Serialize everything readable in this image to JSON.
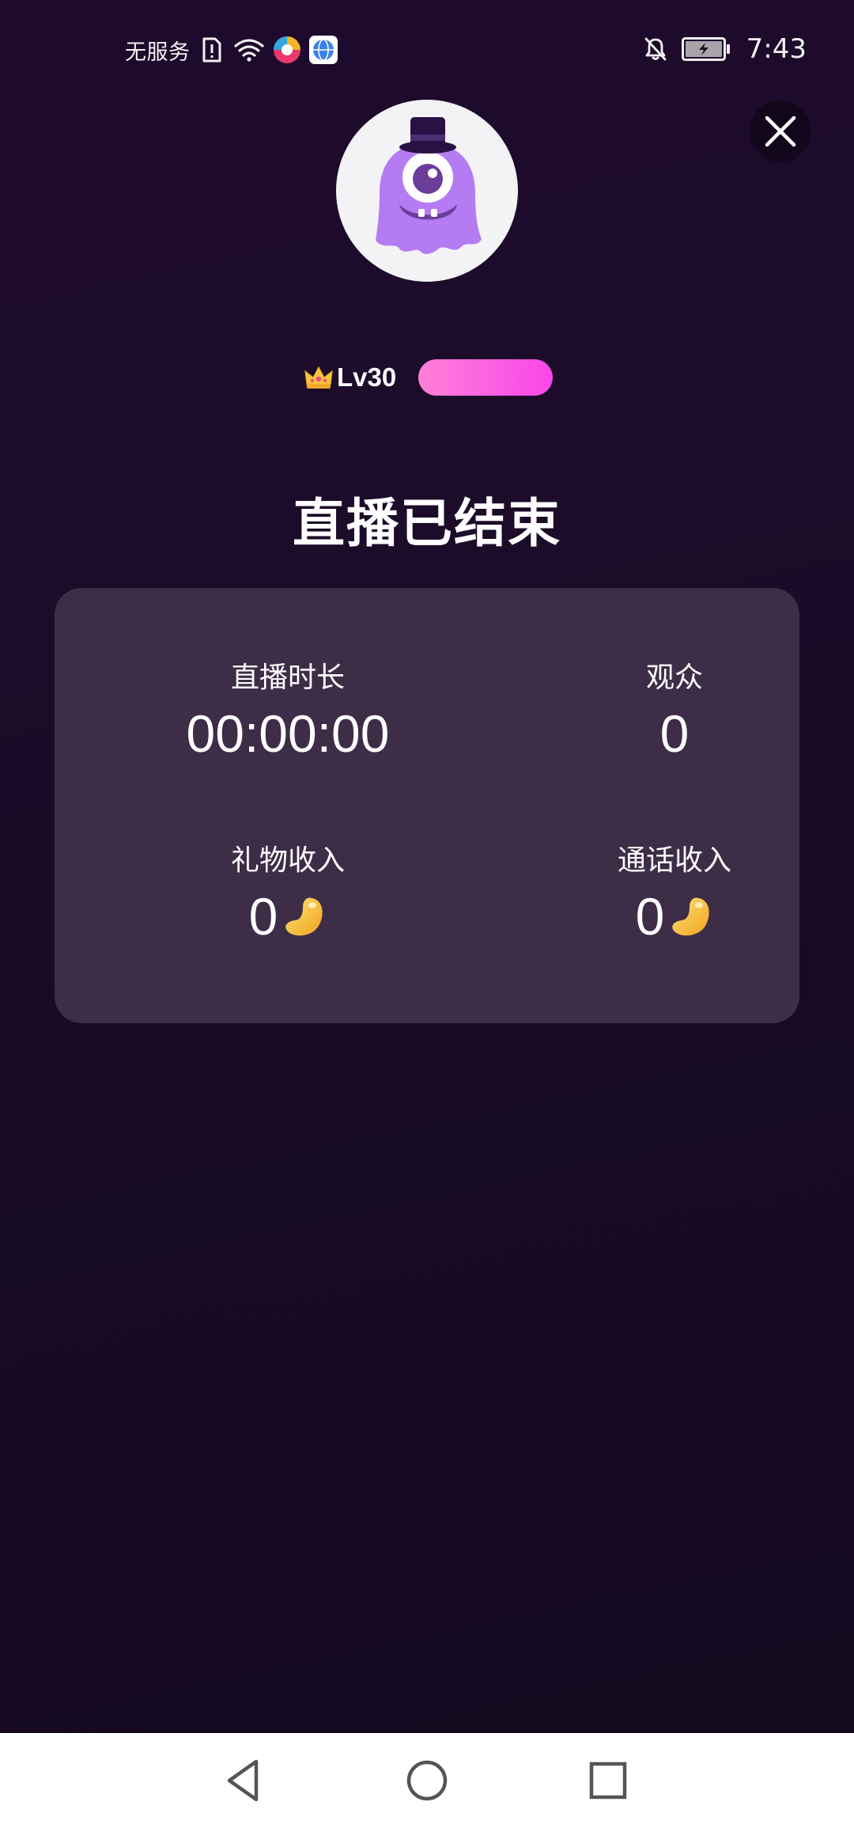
{
  "status_bar": {
    "carrier": "无服务",
    "time": "7:43",
    "icons": [
      "sim-alert-icon",
      "wifi-icon",
      "app-notification-icon",
      "browser-notification-icon",
      "mute-bell-icon",
      "battery-charging-icon"
    ]
  },
  "user": {
    "level": "Lv30",
    "level_icon": "crown-icon",
    "avatar_icon": "one-eyed-monster-with-top-hat"
  },
  "title": "直播已结束",
  "stats": {
    "duration": {
      "label": "直播时长",
      "value": "00:00:00"
    },
    "viewers": {
      "label": "观众",
      "value": "0"
    },
    "gift_income": {
      "label": "礼物收入",
      "value": "0",
      "icon": "bean-coin-icon"
    },
    "call_income": {
      "label": "通话收入",
      "value": "0",
      "icon": "bean-coin-icon"
    }
  },
  "nav": {
    "icons": [
      "back-icon",
      "home-icon",
      "recents-icon"
    ]
  },
  "colors": {
    "background_top": "#1f0a2c",
    "background_bottom": "#140a20",
    "card": "#3d2d47",
    "level_bar_start": "#ff80d8",
    "level_bar_end": "#f945e9",
    "avatar_purple": "#b57bf2"
  }
}
